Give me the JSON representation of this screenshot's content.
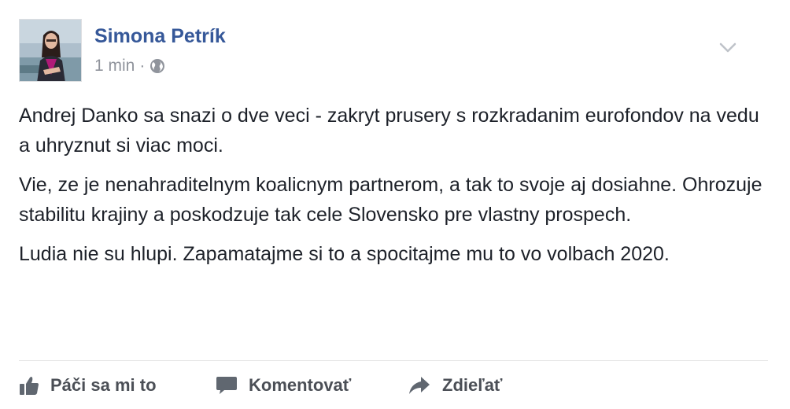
{
  "post": {
    "author": "Simona Petrík",
    "time": "1 min",
    "separator": "·",
    "paragraphs": [
      "Andrej Danko sa snazi o dve veci - zakryt prusery s rozkradanim eurofondov na vedu a uhryznut si viac moci.",
      "Vie, ze je nenahraditelnym koalicnym partnerom, a tak to svoje aj dosiahne. Ohrozuje stabilitu krajiny a poskodzuje tak cele Slovensko pre vlastny prospech.",
      "Ludia nie su hlupi. Zapamatajme si to a spocitajme mu to vo volbach 2020."
    ]
  },
  "actions": {
    "like": "Páči sa mi to",
    "comment": "Komentovať",
    "share": "Zdieľať"
  },
  "icons": {
    "privacy": "globe-icon",
    "menu": "chevron-down-icon",
    "like": "thumbs-up-icon",
    "comment": "speech-bubble-icon",
    "share": "share-arrow-icon"
  },
  "colors": {
    "author_link": "#365899",
    "meta": "#90949c",
    "action_text": "#4b4f56"
  }
}
